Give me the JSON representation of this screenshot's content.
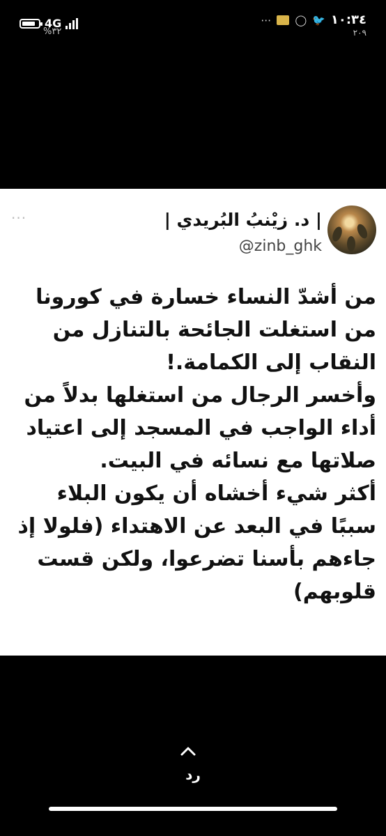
{
  "status_bar": {
    "network": "4G",
    "battery_level": 0.8,
    "battery_percent_text": "%٣٢",
    "time": "١٠:٣٤",
    "date": "٢٠٩"
  },
  "tweet": {
    "display_name": "| د. زيْنبُ البُريدي |",
    "handle": "@zinb_ghk",
    "more_icon": "more-dots-icon",
    "body_lines": [
      "من أشدّ النساء خسارة في كورونا",
      "من استغلت الجائحة بالتنازل من",
      "النقاب إلى الكمامة.!",
      "وأخسر الرجال من استغلها بدلاً من",
      "أداء الواجب في المسجد إلى اعتياد",
      "صلاتها مع نسائه في البيت.",
      "أكثر شيء أخشاه أن يكون البلاء",
      "سببًا في البعد عن الاهتداء (فلولا إذ",
      "جاءهم بأسنا تضرعوا، ولكن قست",
      "قلوبهم)"
    ]
  },
  "reply": {
    "label": "رد",
    "icon": "chevron-up-icon"
  },
  "colors": {
    "background": "#000000",
    "card": "#ffffff",
    "text": "#111111",
    "handle": "#444444"
  }
}
